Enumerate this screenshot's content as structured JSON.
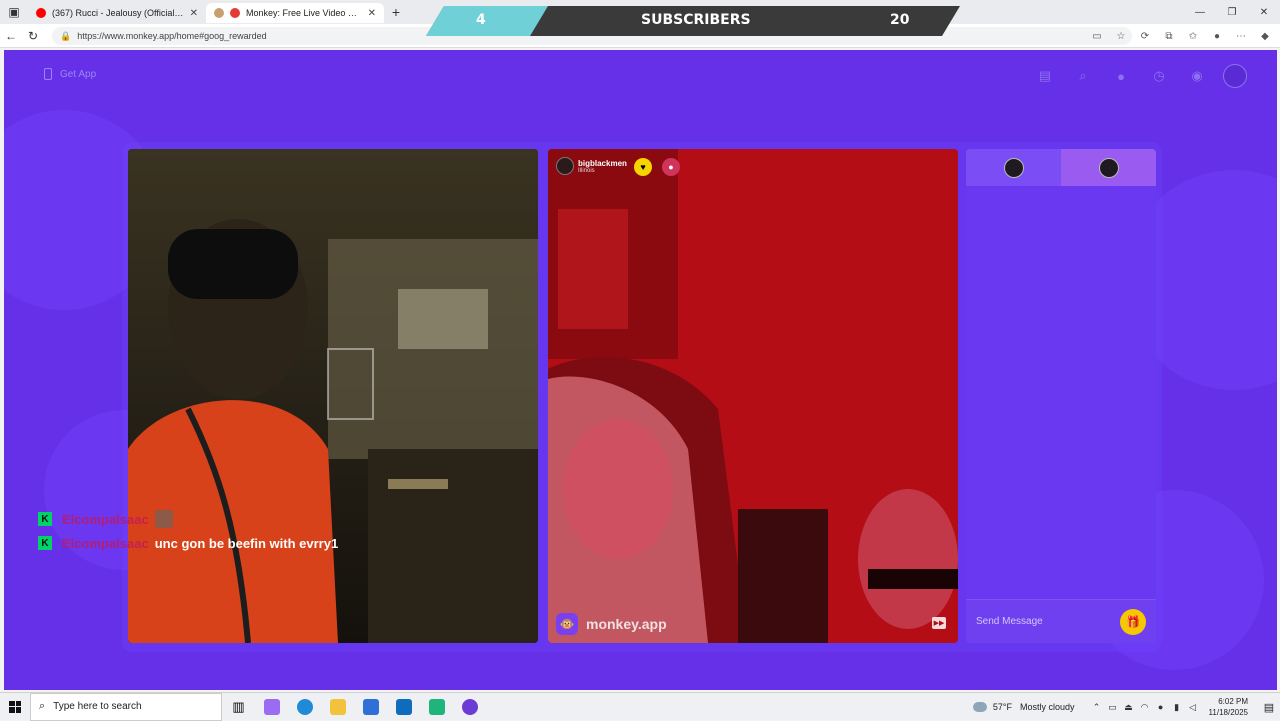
{
  "browser": {
    "tabs": [
      {
        "title": "(367) Rucci - Jealousy (Official Vi...",
        "favicon_color": "#ff0000",
        "active": false
      },
      {
        "title": "Monkey: Free Live Video Cha...",
        "favicon_color": "#e53935",
        "active": true
      }
    ],
    "url": "https://www.monkey.app/home#goog_rewarded"
  },
  "sub_bar": {
    "current": "4",
    "label": "SUBSCRIBERS",
    "goal": "20",
    "progress_fraction": 0.2
  },
  "page": {
    "get_app_label": "Get App",
    "top_icons": [
      "video-icon",
      "search-icon",
      "coin-icon",
      "history-icon",
      "eye-icon",
      "profile-avatar"
    ],
    "remote_user": {
      "name": "bigblackmen",
      "location": "Illinois"
    },
    "watermark": "monkey.app",
    "chat": {
      "placeholder": "Send Message"
    }
  },
  "overlay_chat": {
    "messages": [
      {
        "username": "Elcompalsaac",
        "text": ""
      },
      {
        "username": "Elcompalsaac",
        "text": "unc gon be beefin with evrry1"
      }
    ]
  },
  "taskbar": {
    "search_placeholder": "Type here to search",
    "weather_temp": "57°F",
    "weather_desc": "Mostly cloudy",
    "time": "6:02 PM",
    "date": "11/18/2025"
  }
}
